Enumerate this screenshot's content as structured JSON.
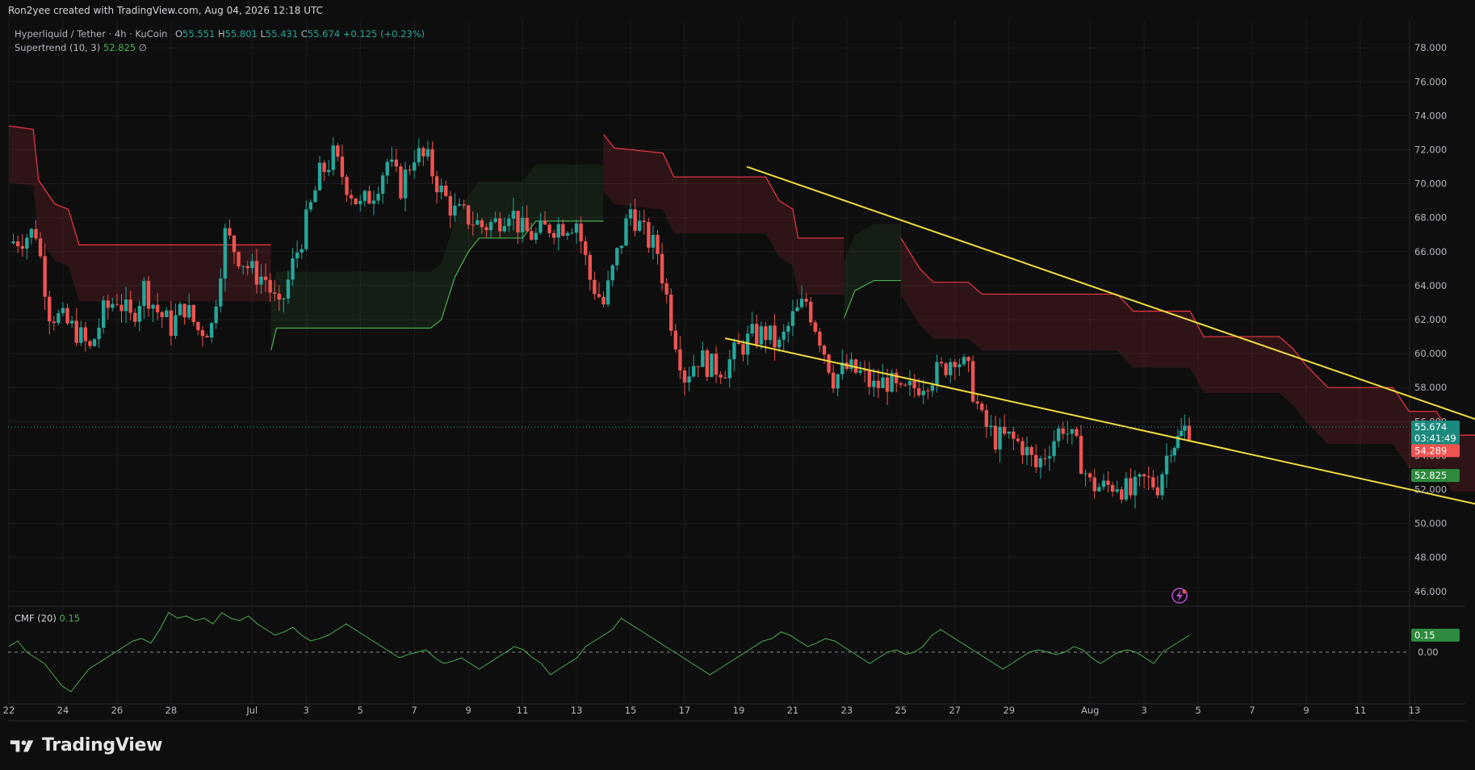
{
  "header": {
    "credit": "Ron2yee created with TradingView.com, Aug 04, 2026 12:18 UTC"
  },
  "legend": {
    "symbol": "Hyperliquid / Tether · 4h · KuCoin",
    "o_label": "O",
    "o_value": "55.551",
    "h_label": "H",
    "h_value": "55.801",
    "l_label": "L",
    "l_value": "55.431",
    "c_label": "C",
    "c_value": "55.674",
    "change": "+0.125 (+0.23%)",
    "indicator_name": "Supertrend (10, 3)",
    "indicator_value": "52.825",
    "indicator_symbol": "∅"
  },
  "cmf_legend": {
    "name": "CMF (20)",
    "value": "0.15"
  },
  "brand": {
    "name": "TradingView"
  },
  "colors": {
    "background": "#0e0e0e",
    "grid": "#1c1c1c",
    "up": "#26a69a",
    "down": "#ef5350",
    "supertrend_up": "#4caf50",
    "supertrend_down": "#f23645",
    "trendline": "#f0dc3c",
    "cmf_line": "#4caf50",
    "price_line": "#26a69a"
  },
  "badges": {
    "price": "55.674",
    "countdown": "03:41:49",
    "supertrend_down": "54.289",
    "supertrend_up": "52.825",
    "cmf": "0.15",
    "cmf_zero": "0.00"
  },
  "chart_data": {
    "type": "candlestick",
    "symbol": "Hyperliquid / Tether",
    "interval": "4h",
    "exchange": "KuCoin",
    "price_axis": {
      "ticks": [
        46,
        48,
        50,
        52,
        54,
        56,
        58,
        60,
        62,
        64,
        66,
        68,
        70,
        72,
        74,
        76,
        78
      ],
      "tick_labels": [
        "46.000",
        "48.000",
        "50.000",
        "52.000",
        "54.000",
        "56.000",
        "58.000",
        "60.000",
        "62.000",
        "64.000",
        "66.000",
        "68.000",
        "70.000",
        "72.000",
        "74.000",
        "76.000",
        "78.000"
      ]
    },
    "time_axis": {
      "labels": [
        "22",
        "24",
        "26",
        "28",
        "Jul",
        "3",
        "5",
        "7",
        "9",
        "11",
        "13",
        "15",
        "17",
        "19",
        "21",
        "23",
        "25",
        "27",
        "29",
        "Aug",
        "3",
        "5",
        "7",
        "9",
        "11",
        "13"
      ],
      "label_day_index": [
        0,
        2,
        4,
        6,
        9,
        11,
        13,
        15,
        17,
        19,
        21,
        23,
        25,
        27,
        29,
        31,
        33,
        35,
        37,
        40,
        42,
        44,
        46,
        48,
        50,
        52
      ],
      "note": "day_index 0 = Jun 22"
    },
    "ohlc_summary": [
      {
        "day": 0.0,
        "close": 66.5
      },
      {
        "day": 1.0,
        "close": 67.2
      },
      {
        "day": 1.5,
        "close": 62.5
      },
      {
        "day": 2.5,
        "close": 61.3
      },
      {
        "day": 3.0,
        "close": 60.2
      },
      {
        "day": 3.5,
        "close": 62.4
      },
      {
        "day": 4.0,
        "close": 63.3
      },
      {
        "day": 4.5,
        "close": 62.0
      },
      {
        "day": 5.0,
        "close": 63.9
      },
      {
        "day": 5.5,
        "close": 62.5
      },
      {
        "day": 6.0,
        "close": 61.6
      },
      {
        "day": 6.5,
        "close": 62.8
      },
      {
        "day": 7.0,
        "close": 61.4
      },
      {
        "day": 7.5,
        "close": 61.6
      },
      {
        "day": 8.0,
        "close": 67.0
      },
      {
        "day": 8.5,
        "close": 65.8
      },
      {
        "day": 9.0,
        "close": 64.8
      },
      {
        "day": 9.5,
        "close": 64.4
      },
      {
        "day": 10.0,
        "close": 62.4
      },
      {
        "day": 10.5,
        "close": 65.2
      },
      {
        "day": 11.0,
        "close": 67.7
      },
      {
        "day": 11.5,
        "close": 70.5
      },
      {
        "day": 12.0,
        "close": 71.6
      },
      {
        "day": 12.5,
        "close": 70.0
      },
      {
        "day": 13.0,
        "close": 68.6
      },
      {
        "day": 13.5,
        "close": 69.6
      },
      {
        "day": 14.0,
        "close": 71.3
      },
      {
        "day": 14.5,
        "close": 69.8
      },
      {
        "day": 15.0,
        "close": 71.8
      },
      {
        "day": 15.5,
        "close": 71.3
      },
      {
        "day": 16.0,
        "close": 69.5
      },
      {
        "day": 16.5,
        "close": 68.3
      },
      {
        "day": 17.0,
        "close": 68.0
      },
      {
        "day": 17.5,
        "close": 67.5
      },
      {
        "day": 18.0,
        "close": 67.7
      },
      {
        "day": 18.5,
        "close": 68.6
      },
      {
        "day": 19.0,
        "close": 67.2
      },
      {
        "day": 19.5,
        "close": 66.9
      },
      {
        "day": 20.0,
        "close": 67.5
      },
      {
        "day": 20.5,
        "close": 67.6
      },
      {
        "day": 21.0,
        "close": 67.8
      },
      {
        "day": 21.5,
        "close": 64.4
      },
      {
        "day": 22.0,
        "close": 62.9
      },
      {
        "day": 22.5,
        "close": 65.8
      },
      {
        "day": 23.0,
        "close": 68.5
      },
      {
        "day": 23.5,
        "close": 67.0
      },
      {
        "day": 24.0,
        "close": 66.0
      },
      {
        "day": 24.5,
        "close": 62.0
      },
      {
        "day": 25.0,
        "close": 58.7
      },
      {
        "day": 25.5,
        "close": 59.8
      },
      {
        "day": 26.0,
        "close": 59.2
      },
      {
        "day": 26.5,
        "close": 59.2
      },
      {
        "day": 27.0,
        "close": 60.3
      },
      {
        "day": 27.5,
        "close": 61.0
      },
      {
        "day": 28.0,
        "close": 61.2
      },
      {
        "day": 28.5,
        "close": 60.4
      },
      {
        "day": 29.0,
        "close": 62.1
      },
      {
        "day": 29.5,
        "close": 63.1
      },
      {
        "day": 30.0,
        "close": 61.0
      },
      {
        "day": 30.5,
        "close": 58.6
      },
      {
        "day": 31.0,
        "close": 59.1
      },
      {
        "day": 31.5,
        "close": 58.8
      },
      {
        "day": 32.0,
        "close": 58.0
      },
      {
        "day": 32.5,
        "close": 58.4
      },
      {
        "day": 33.0,
        "close": 57.5
      },
      {
        "day": 33.5,
        "close": 58.0
      },
      {
        "day": 34.0,
        "close": 58.6
      },
      {
        "day": 34.5,
        "close": 59.0
      },
      {
        "day": 35.0,
        "close": 60.0
      },
      {
        "day": 35.5,
        "close": 58.8
      },
      {
        "day": 36.0,
        "close": 56.0
      },
      {
        "day": 36.5,
        "close": 55.0
      },
      {
        "day": 37.0,
        "close": 55.0
      },
      {
        "day": 37.5,
        "close": 54.6
      },
      {
        "day": 38.0,
        "close": 53.3
      },
      {
        "day": 38.5,
        "close": 54.6
      },
      {
        "day": 39.0,
        "close": 55.8
      },
      {
        "day": 39.5,
        "close": 54.4
      },
      {
        "day": 40.0,
        "close": 52.3
      },
      {
        "day": 40.5,
        "close": 52.1
      },
      {
        "day": 41.0,
        "close": 52.4
      },
      {
        "day": 41.5,
        "close": 51.7
      },
      {
        "day": 42.0,
        "close": 52.5
      },
      {
        "day": 42.5,
        "close": 52.3
      },
      {
        "day": 43.0,
        "close": 54.8
      },
      {
        "day": 43.25,
        "close": 54.9
      },
      {
        "day": 43.5,
        "close": 55.55
      },
      {
        "day": 43.67,
        "close": 55.674
      }
    ],
    "supertrend": {
      "name": "Supertrend (10, 3)",
      "current": 52.825,
      "segments": [
        {
          "dir": "down",
          "points": [
            [
              0,
              73.4
            ],
            [
              0.9,
              73.2
            ],
            [
              1.1,
              70.2
            ],
            [
              1.7,
              68.8
            ],
            [
              2.2,
              68.5
            ],
            [
              2.6,
              66.4
            ],
            [
              9.7,
              66.4
            ]
          ]
        },
        {
          "dir": "up",
          "points": [
            [
              9.7,
              60.2
            ],
            [
              9.9,
              61.5
            ],
            [
              15.6,
              61.5
            ],
            [
              16.0,
              62.0
            ],
            [
              16.5,
              64.5
            ],
            [
              17.0,
              66.0
            ],
            [
              17.4,
              66.8
            ],
            [
              19.0,
              66.8
            ],
            [
              19.5,
              67.8
            ],
            [
              22.0,
              67.8
            ]
          ]
        },
        {
          "dir": "down",
          "points": [
            [
              22.0,
              72.9
            ],
            [
              22.4,
              72.1
            ],
            [
              24.2,
              71.8
            ],
            [
              24.6,
              70.4
            ],
            [
              28.0,
              70.4
            ],
            [
              28.5,
              69.0
            ],
            [
              29.0,
              68.5
            ],
            [
              29.2,
              66.8
            ],
            [
              30.9,
              66.8
            ]
          ]
        },
        {
          "dir": "up",
          "points": [
            [
              30.9,
              62.1
            ],
            [
              31.3,
              63.7
            ],
            [
              32.0,
              64.3
            ],
            [
              33.0,
              64.3
            ]
          ]
        },
        {
          "dir": "down",
          "points": [
            [
              33.0,
              66.8
            ],
            [
              33.7,
              65.0
            ],
            [
              34.2,
              64.2
            ],
            [
              35.5,
              64.2
            ],
            [
              36.0,
              63.5
            ],
            [
              41.0,
              63.5
            ],
            [
              41.6,
              62.5
            ],
            [
              43.7,
              62.5
            ],
            [
              44.2,
              61.0
            ],
            [
              47.0,
              61.0
            ],
            [
              47.5,
              60.3
            ],
            [
              48.0,
              59.3
            ],
            [
              48.8,
              58.0
            ],
            [
              51.2,
              58.0
            ],
            [
              51.8,
              56.6
            ],
            [
              52.8,
              56.6
            ],
            [
              53.4,
              55.2
            ],
            [
              56.5,
              55.2
            ],
            [
              57.0,
              54.3
            ]
          ]
        },
        {
          "dir": "up",
          "points": [
            [
              56.9,
              50.6
            ],
            [
              57.2,
              51.8
            ],
            [
              57.6,
              51.9
            ],
            [
              58.0,
              52.8
            ]
          ]
        }
      ]
    },
    "trendlines": [
      {
        "name": "upper",
        "points": [
          [
            27.3,
            71.0
          ],
          [
            64.3,
            50.6
          ]
        ]
      },
      {
        "name": "lower",
        "points": [
          [
            26.5,
            60.9
          ],
          [
            63.8,
            47.8
          ]
        ]
      }
    ],
    "current_price": 55.674,
    "cmf": {
      "name": "CMF (20)",
      "current": 0.15,
      "zero_label": "0.00",
      "series": [
        0.05,
        0.1,
        0.0,
        -0.05,
        -0.1,
        -0.2,
        -0.3,
        -0.35,
        -0.25,
        -0.15,
        -0.1,
        -0.05,
        0.0,
        0.05,
        0.1,
        0.12,
        0.08,
        0.2,
        0.35,
        0.3,
        0.32,
        0.28,
        0.3,
        0.25,
        0.35,
        0.3,
        0.28,
        0.32,
        0.25,
        0.2,
        0.15,
        0.18,
        0.22,
        0.15,
        0.1,
        0.12,
        0.15,
        0.2,
        0.25,
        0.2,
        0.15,
        0.1,
        0.05,
        0.0,
        -0.05,
        -0.02,
        0.0,
        0.02,
        -0.05,
        -0.1,
        -0.08,
        -0.05,
        -0.1,
        -0.15,
        -0.1,
        -0.05,
        0.0,
        0.05,
        0.02,
        -0.05,
        -0.1,
        -0.2,
        -0.15,
        -0.1,
        -0.05,
        0.05,
        0.1,
        0.15,
        0.2,
        0.3,
        0.25,
        0.2,
        0.15,
        0.1,
        0.05,
        0.0,
        -0.05,
        -0.1,
        -0.15,
        -0.2,
        -0.15,
        -0.1,
        -0.05,
        0.0,
        0.05,
        0.1,
        0.12,
        0.18,
        0.15,
        0.1,
        0.05,
        0.08,
        0.12,
        0.1,
        0.05,
        0.0,
        -0.05,
        -0.1,
        -0.05,
        0.0,
        0.02,
        -0.02,
        0.0,
        0.05,
        0.15,
        0.2,
        0.15,
        0.1,
        0.05,
        0.0,
        -0.05,
        -0.1,
        -0.15,
        -0.1,
        -0.05,
        0.0,
        0.02,
        0.0,
        -0.02,
        0.0,
        0.05,
        0.02,
        -0.05,
        -0.1,
        -0.05,
        0.0,
        0.02,
        0.0,
        -0.05,
        -0.1,
        0.0,
        0.05,
        0.1,
        0.15
      ]
    }
  }
}
